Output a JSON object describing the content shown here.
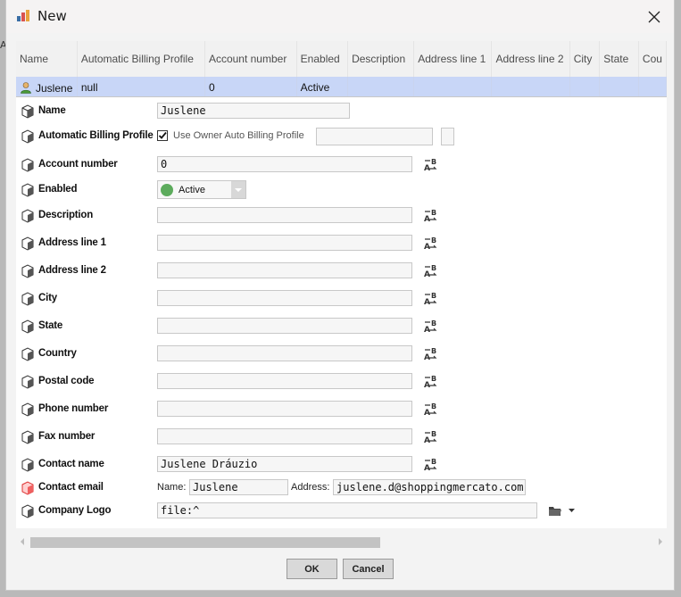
{
  "window": {
    "title": "New",
    "backdrop_letter": "A"
  },
  "grid": {
    "columns": [
      "Name",
      "Automatic Billing Profile",
      "Account number",
      "Enabled",
      "Description",
      "Address line 1",
      "Address line 2",
      "City",
      "State",
      "Cou"
    ],
    "rows": [
      [
        "Juslene",
        "null",
        "0",
        "Active",
        "",
        "",
        "",
        "",
        "",
        ""
      ]
    ]
  },
  "form": {
    "name": {
      "label": "Name",
      "value": "Juslene"
    },
    "auto_billing": {
      "label": "Automatic Billing Profile",
      "checkbox_label": "Use Owner Auto Billing Profile",
      "checked": true,
      "value": ""
    },
    "account_number": {
      "label": "Account number",
      "value": "0"
    },
    "enabled": {
      "label": "Enabled",
      "value": "Active",
      "status_color": "#5cab5c"
    },
    "description": {
      "label": "Description",
      "value": ""
    },
    "address1": {
      "label": "Address line 1",
      "value": ""
    },
    "address2": {
      "label": "Address line 2",
      "value": ""
    },
    "city": {
      "label": "City",
      "value": ""
    },
    "state": {
      "label": "State",
      "value": ""
    },
    "country": {
      "label": "Country",
      "value": ""
    },
    "postal_code": {
      "label": "Postal code",
      "value": ""
    },
    "phone": {
      "label": "Phone number",
      "value": ""
    },
    "fax": {
      "label": "Fax number",
      "value": ""
    },
    "contact_name": {
      "label": "Contact name",
      "value": "Juslene Dráuzio"
    },
    "contact_email": {
      "label": "Contact email",
      "name_label": "Name:",
      "name_value": "Juslene",
      "address_label": "Address:",
      "address_value": "juslene.d@shoppingmercato.com.br"
    },
    "company_logo": {
      "label": "Company Logo",
      "value": "file:^"
    }
  },
  "buttons": {
    "ok": "OK",
    "cancel": "Cancel"
  },
  "icons": {
    "prop": "property-cube-icon",
    "prop_error": "property-cube-error-icon",
    "ab": "ab-transform-icon",
    "folder": "folder-icon"
  }
}
